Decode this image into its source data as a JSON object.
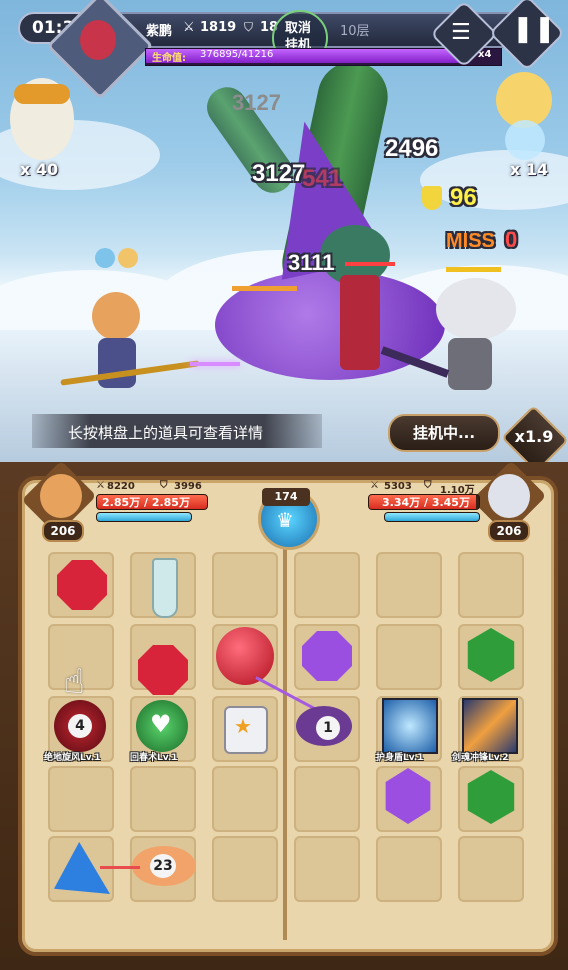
{
  "timer": "01:3",
  "player": {
    "name": "紫鹏",
    "attack": "1819",
    "defense": "18"
  },
  "afk_toggle": "取消\n挂机",
  "floor": "10层",
  "boss_hp": {
    "label": "生命值:",
    "value": "376895/41216",
    "multiplier": "x4",
    "fraction": 0.9
  },
  "left_pet": {
    "count": "x 40"
  },
  "right_pet": {
    "count": "x 14"
  },
  "damage_numbers": [
    "3127",
    "3127",
    "541",
    "2496",
    "3111"
  ],
  "shield_value": "96",
  "miss": {
    "label": "MISS",
    "value": "0"
  },
  "hint_text": "长按棋盘上的道具可查看详情",
  "afk_status_button": "挂机中...",
  "speed_button": "x1.9",
  "left_hero": {
    "attack": "8220",
    "defense": "3996",
    "hp": "2.85万 / 2.85万",
    "level": "206",
    "hp_fraction": 1.0
  },
  "right_hero": {
    "attack": "5303",
    "defense": "1.10万",
    "hp": "3.34万 / 3.45万",
    "level": "206",
    "hp_fraction": 0.97
  },
  "center_counter": "174",
  "items": {
    "skill_1": {
      "label": "绝地旋风Lv.1",
      "count": "4"
    },
    "skill_2": {
      "label": "回春术Lv.1"
    },
    "skill_3": {
      "label": "护身盾Lv.1"
    },
    "skill_4": {
      "label": "剑魂冲锋Lv.2"
    },
    "egg_count": "1",
    "pig_count": "23"
  },
  "colors": {
    "red_gem": "#d8243a",
    "purple_gem": "#9b4fe0",
    "green_gem": "#2f9e3a",
    "blue_gem": "#2d7fe0",
    "boss_hp": "#a233e0"
  }
}
